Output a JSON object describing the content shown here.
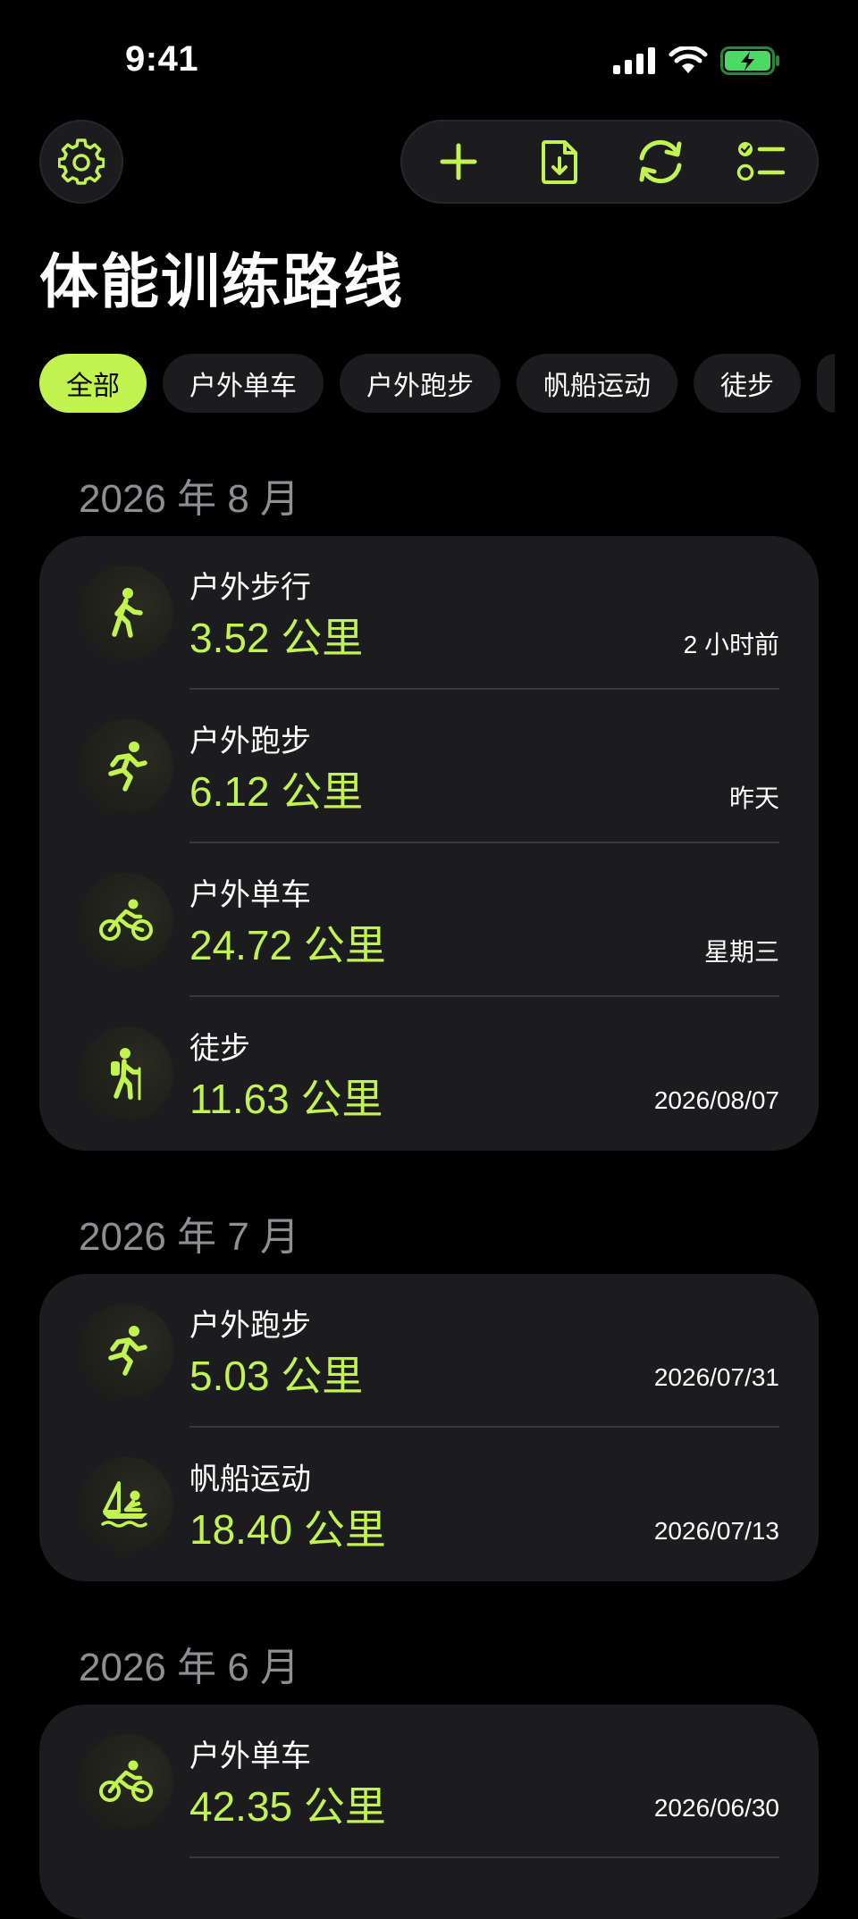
{
  "status": {
    "time": "9:41"
  },
  "title": "体能训练路线",
  "filters": [
    {
      "label": "全部",
      "active": true
    },
    {
      "label": "户外单车",
      "active": false
    },
    {
      "label": "户外跑步",
      "active": false
    },
    {
      "label": "帆船运动",
      "active": false
    },
    {
      "label": "徒步",
      "active": false
    }
  ],
  "sections": [
    {
      "header": "2026 年 8 月",
      "items": [
        {
          "title": "户外步行",
          "distance": "3.52 公里",
          "date": "2 小时前",
          "icon": "walking-icon"
        },
        {
          "title": "户外跑步",
          "distance": "6.12 公里",
          "date": "昨天",
          "icon": "running-icon"
        },
        {
          "title": "户外单车",
          "distance": "24.72 公里",
          "date": "星期三",
          "icon": "cycling-icon"
        },
        {
          "title": "徒步",
          "distance": "11.63 公里",
          "date": "2026/08/07",
          "icon": "hiking-icon"
        }
      ]
    },
    {
      "header": "2026 年 7 月",
      "items": [
        {
          "title": "户外跑步",
          "distance": "5.03 公里",
          "date": "2026/07/31",
          "icon": "running-icon"
        },
        {
          "title": "帆船运动",
          "distance": "18.40 公里",
          "date": "2026/07/13",
          "icon": "sailing-icon"
        }
      ]
    },
    {
      "header": "2026 年 6 月",
      "items": [
        {
          "title": "户外单车",
          "distance": "42.35 公里",
          "date": "2026/06/30",
          "icon": "cycling-icon"
        }
      ]
    }
  ],
  "colors": {
    "accent": "#c2f450",
    "card": "#1c1c1e",
    "background": "#000000",
    "section_header": "#8e8e93"
  }
}
